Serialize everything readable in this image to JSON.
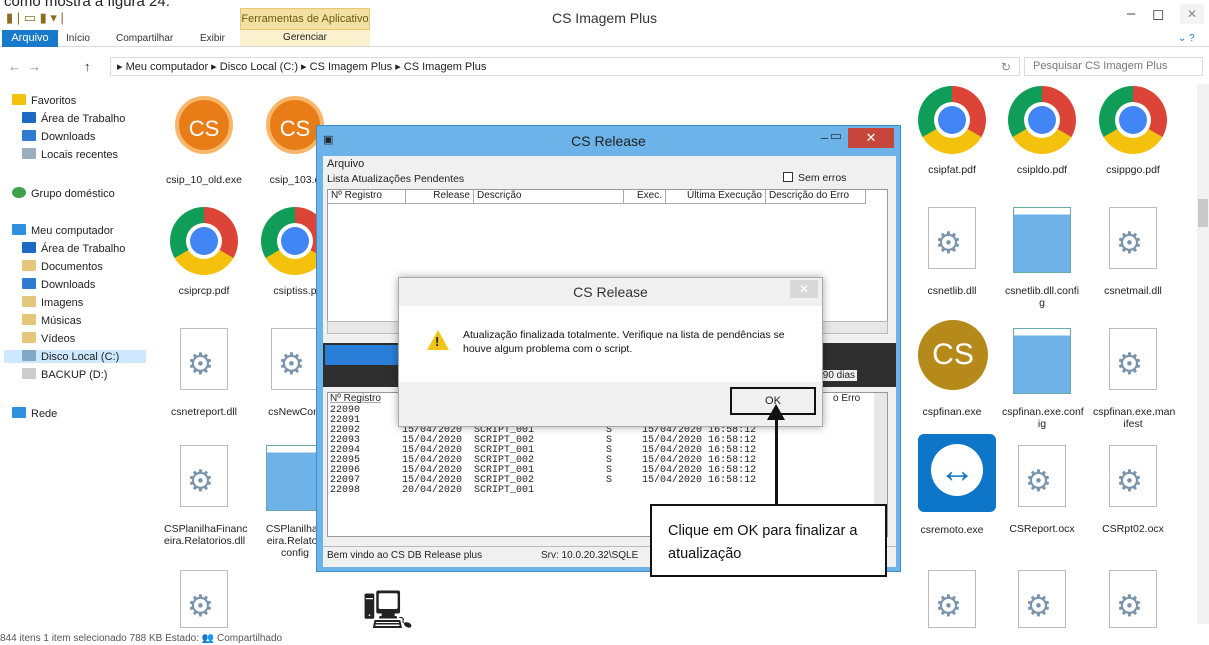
{
  "doc_caption": "como mostra a figura 24:",
  "window": {
    "title": "CS Imagem Plus",
    "context_tab": "Ferramentas de Aplicativo",
    "context_sub": "Gerenciar",
    "minimize": "–",
    "maximize": "◻",
    "close": "✕"
  },
  "ribbon": {
    "tabs": [
      "Arquivo",
      "Início",
      "Compartilhar",
      "Exibir"
    ]
  },
  "address": {
    "back": "←",
    "forward": "→",
    "up": "↑",
    "refresh": "↻",
    "path": "▸ Meu computador  ▸  Disco Local (C:)  ▸  CS Imagem Plus  ▸  CS Imagem Plus",
    "search_placeholder": "Pesquisar CS Imagem Plus"
  },
  "nav": {
    "favorites": "Favoritos",
    "fav_items": [
      "Área de Trabalho",
      "Downloads",
      "Locais recentes"
    ],
    "homegroup": "Grupo doméstico",
    "computer": "Meu computador",
    "computer_items": [
      "Área de Trabalho",
      "Documentos",
      "Downloads",
      "Imagens",
      "Músicas",
      "Vídeos",
      "Disco Local (C:)",
      "BACKUP (D:)"
    ],
    "network": "Rede"
  },
  "files": {
    "row1": [
      "csip_10_old.exe",
      "csip_103.e",
      "csipfat.pdf",
      "csipldo.pdf",
      "csippgo.pdf"
    ],
    "row2": [
      "csiprcp.pdf",
      "csiptiss.p",
      "csnetlib.dll",
      "csnetlib.dll.confi g",
      "csnetmail.dll"
    ],
    "row3": [
      "csnetreport.dll",
      "csNewCom",
      "cspfinan.exe",
      "cspfinan.exe.conf ig",
      "cspfinan.exe.man ifest"
    ],
    "row4": [
      "CSPlanilhaFinanc eira.Relatorios.dll",
      "CSPlanilhaF eira.Relatori config",
      "csremoto.exe",
      "CSReport.ocx",
      "CSRpt02.ocx"
    ]
  },
  "status": {
    "text": "844 itens    1 item selecionado  788 KB    Estado: 👥 Compartilhado"
  },
  "cs_release": {
    "title": "CS Release",
    "menu": "Arquivo",
    "pending_label": "Lista Atualizações Pendentes",
    "no_errors": "Sem erros",
    "columns": [
      "Nº Registro",
      "Release",
      "Descrição",
      "Exec.",
      "Última Execução",
      "Descrição do Erro"
    ],
    "history_info": "s 90 dias",
    "history_header": "Nº Registro",
    "history_err": "o Erro",
    "rows": [
      "22090",
      "22091",
      "22092       15/04/2020  SCRIPT_001            S     15/04/2020 16:58:12",
      "22093       15/04/2020  SCRIPT_002            S     15/04/2020 16:58:12",
      "22094       15/04/2020  SCRIPT_001            S     15/04/2020 16:58:12",
      "22095       15/04/2020  SCRIPT_002            S     15/04/2020 16:58:12",
      "22096       15/04/2020  SCRIPT_001            S     15/04/2020 16:58:12",
      "22097       15/04/2020  SCRIPT_002            S     15/04/2020 16:58:12",
      "22098       20/04/2020  SCRIPT_001"
    ],
    "status_left": "Bem vindo ao CS DB Release plus",
    "status_right": "Srv: 10.0.20.32\\SQLE"
  },
  "dialog": {
    "title": "CS Release",
    "message": "Atualização finalizada totalmente. Verifique na lista de pendências se houve algum problema com o script.",
    "ok": "OK",
    "close": "✕"
  },
  "callout": {
    "text": "Clique em OK para finalizar a atualização"
  }
}
